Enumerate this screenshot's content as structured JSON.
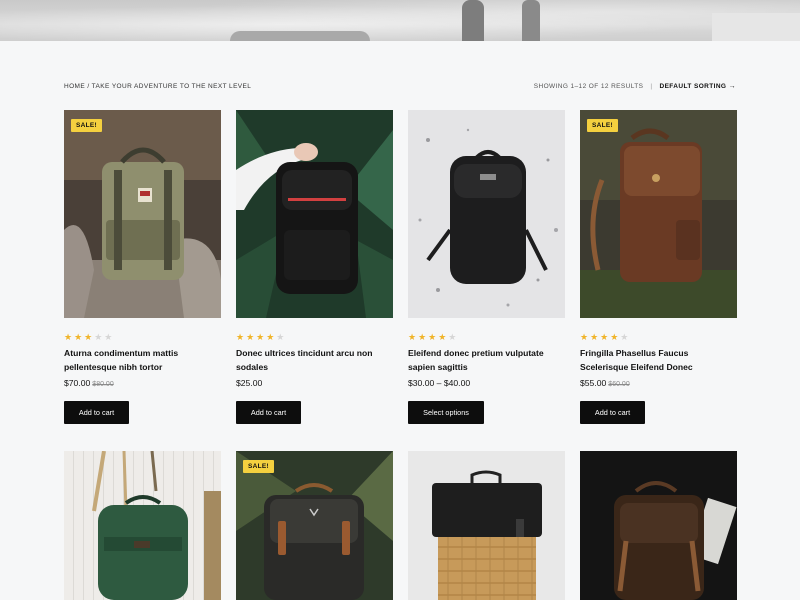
{
  "breadcrumb": {
    "home": "HOME",
    "separator": "/",
    "current": "TAKE YOUR ADVENTURE TO THE NEXT LEVEL"
  },
  "results_text": "SHOWING 1–12 OF 12 RESULTS",
  "result_separator": "|",
  "sorting": {
    "label": "DEFAULT SORTING",
    "arrow": "→"
  },
  "products": [
    {
      "sale": "SALE!",
      "rating": 3,
      "name": "Aturna condimentum mattis pellentesque nibh tortor",
      "price": "$70.00",
      "old_price": "$80.00",
      "button": "Add to cart"
    },
    {
      "sale": "",
      "rating": 4,
      "name": "Donec ultrices tincidunt arcu non sodales",
      "price": "$25.00",
      "old_price": "",
      "button": "Add to cart"
    },
    {
      "sale": "",
      "rating": 4,
      "name": "Eleifend donec pretium vulputate sapien sagittis",
      "price": "$30.00 – $40.00",
      "old_price": "",
      "button": "Select options"
    },
    {
      "sale": "SALE!",
      "rating": 4,
      "name": "Fringilla Phasellus Faucus Scelerisque Eleifend Donec",
      "price": "$55.00",
      "old_price": "$60.00",
      "button": "Add to cart"
    },
    {
      "sale": ""
    },
    {
      "sale": "SALE!"
    },
    {
      "sale": ""
    },
    {
      "sale": ""
    }
  ],
  "colors": {
    "sale_badge": "#f4d03f",
    "star": "#f0b429",
    "button": "#0d0d0d",
    "background": "#f6f7f8"
  }
}
